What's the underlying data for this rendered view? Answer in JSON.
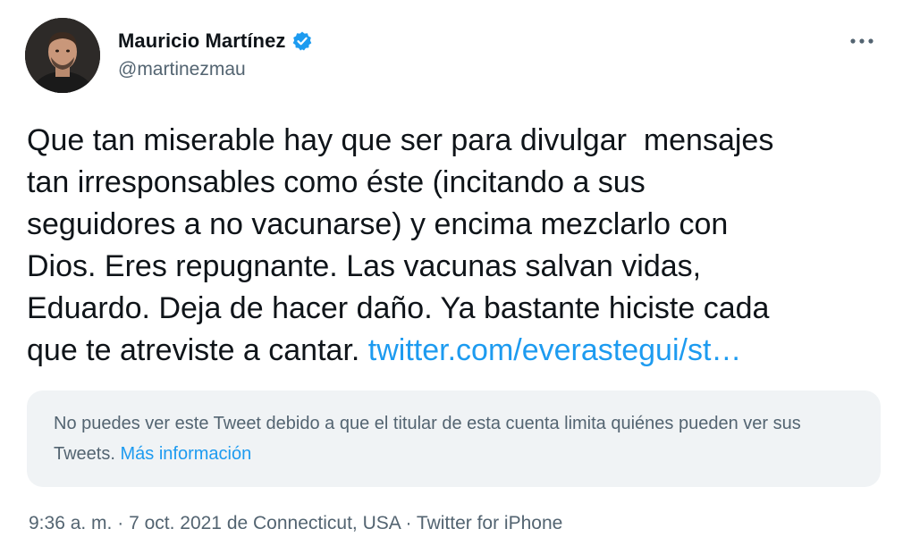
{
  "tweet": {
    "author": {
      "display_name": "Mauricio Martínez",
      "handle": "@martinezmau",
      "verified": true,
      "avatar_icon": "user-avatar-photo"
    },
    "more_icon": "more-horizontal-icon",
    "text_lines": [
      "Que tan miserable hay que ser para divulgar  mensajes",
      "tan irresponsables como éste (incitando a sus",
      "seguidores a no vacunarse) y encima mezclarlo con",
      "Dios. Eres repugnante. Las vacunas salvan vidas,",
      "Eduardo. Deja de hacer daño. Ya bastante hiciste cada",
      "que te atreviste a cantar. "
    ],
    "link_text": "twitter.com/everastegui/st…",
    "quoted_notice": {
      "text": "No puedes ver este Tweet debido a que el titular de esta cuenta limita quiénes pueden ver sus Tweets. ",
      "link": "Más información"
    },
    "meta": {
      "time": "9:36 a. m.",
      "date": "7 oct. 2021",
      "location": "de Connecticut, USA",
      "client": "Twitter for iPhone",
      "separator": " · "
    },
    "colors": {
      "text": "#0f1419",
      "secondary": "#536471",
      "link": "#1d9bf0",
      "notice_bg": "#f0f3f5"
    }
  }
}
